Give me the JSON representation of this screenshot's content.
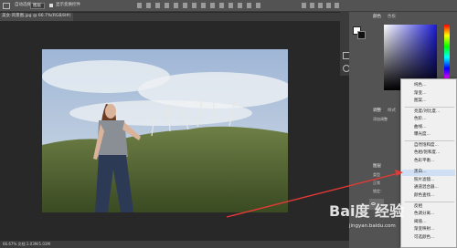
{
  "options_bar": {
    "auto_select_label": "自动选择：",
    "layer_dropdown": "图层",
    "show_transform_label": "显示变换控件"
  },
  "document": {
    "tab_title": "美女-风景图.jpg @ 66.7%(RGB/8#)",
    "status_text": "66.67%  文档:1.03M/1.03M"
  },
  "panels": {
    "color_tab": "颜色",
    "swatches_tab": "色板",
    "adjust_tab": "调整",
    "styles_tab": "样式",
    "add_adjustment_label": "添加调整",
    "layers_tab": "图层",
    "type_label": "类型",
    "blend_mode": "正常",
    "lock_label": "锁定："
  },
  "context_menu": {
    "items": [
      "纯色...",
      "渐变...",
      "图案...",
      "亮度/对比度...",
      "色阶...",
      "曲线...",
      "曝光度...",
      "自然饱和度...",
      "色相/饱和度...",
      "色彩平衡...",
      "黑白...",
      "照片滤镜...",
      "通道混合器...",
      "颜色查找...",
      "反相",
      "色调分离...",
      "阈值...",
      "渐变映射...",
      "可选颜色..."
    ],
    "highlighted": "黑白..."
  },
  "watermark": {
    "text": "Bai度 经验",
    "url": "jingyan.baidu.com"
  },
  "colors": {
    "menu_bg": "#f0f0f0",
    "highlight": "#cfe0f5",
    "arrow": "#e53935"
  }
}
